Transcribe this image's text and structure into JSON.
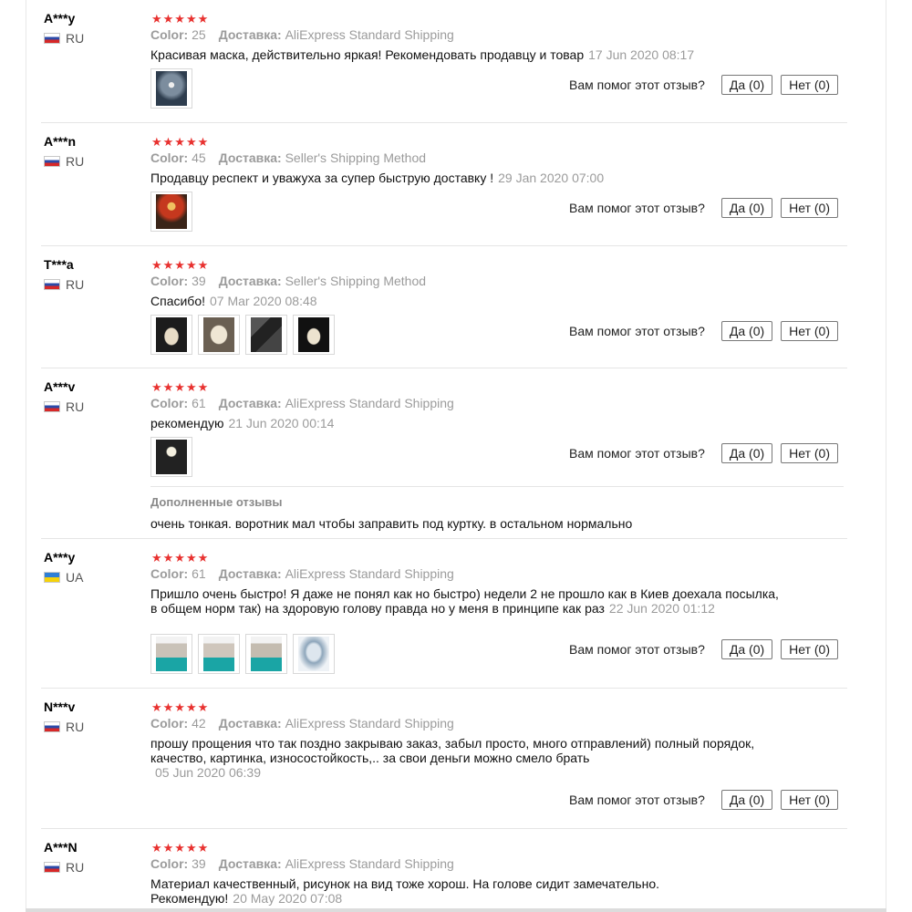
{
  "helpful_question": "Вам помог этот отзыв?",
  "stars_text": "★★★★★",
  "labels": {
    "color": "Color:",
    "shipping": "Доставка:"
  },
  "reviews": [
    {
      "user": "A***y",
      "country": "RU",
      "color": "25",
      "shipping": "AliExpress Standard Shipping",
      "text": "Красивая маска, действительно яркая! Рекомендовать продавцу и товар",
      "date": "17 Jun 2020 08:17",
      "yes": "Да (0)",
      "no": "Нет (0)"
    },
    {
      "user": "A***n",
      "country": "RU",
      "color": "45",
      "shipping": "Seller's Shipping Method",
      "text": "Продавцу респект и уважуха за супер быструю доставку !",
      "date": "29 Jan 2020 07:00",
      "yes": "Да (0)",
      "no": "Нет (0)"
    },
    {
      "user": "T***a",
      "country": "RU",
      "color": "39",
      "shipping": "Seller's Shipping Method",
      "text": "Спасибо!",
      "date": "07 Mar 2020 08:48",
      "yes": "Да (0)",
      "no": "Нет (0)"
    },
    {
      "user": "A***v",
      "country": "RU",
      "color": "61",
      "shipping": "AliExpress Standard Shipping",
      "text": "рекомендую",
      "date": "21 Jun 2020 00:14",
      "yes": "Да (0)",
      "no": "Нет (0)",
      "additional_title": "Дополненные отзывы",
      "additional_text": "очень тонкая. воротник мал чтобы заправить под куртку. в остальном нормально"
    },
    {
      "user": "A***y",
      "country": "UA",
      "color": "61",
      "shipping": "AliExpress Standard Shipping",
      "text": "Пришло очень быстро! Я даже не понял как но быстро) недели 2 не прошло как в Киев доехала посылка, в общем норм так) на здоровую голову правда но у меня в принципе как раз",
      "date": "22 Jun 2020 01:12",
      "yes": "Да (0)",
      "no": "Нет (0)"
    },
    {
      "user": "N***v",
      "country": "RU",
      "color": "42",
      "shipping": "AliExpress Standard Shipping",
      "text": "прошу прощения что так поздно закрываю заказ, забыл просто, много отправлений) полный порядок, качество, картинка, износостойкость,.. за свои деньги можно смело брать",
      "date": "05 Jun 2020 06:39",
      "yes": "Да (0)",
      "no": "Нет (0)"
    },
    {
      "user": "A***N",
      "country": "RU",
      "color": "39",
      "shipping": "AliExpress Standard Shipping",
      "text": "Материал качественный, рисунок на вид тоже хорош. На голове сидит замечательно. Рекомендую!",
      "date": "20 May 2020 07:08"
    }
  ]
}
